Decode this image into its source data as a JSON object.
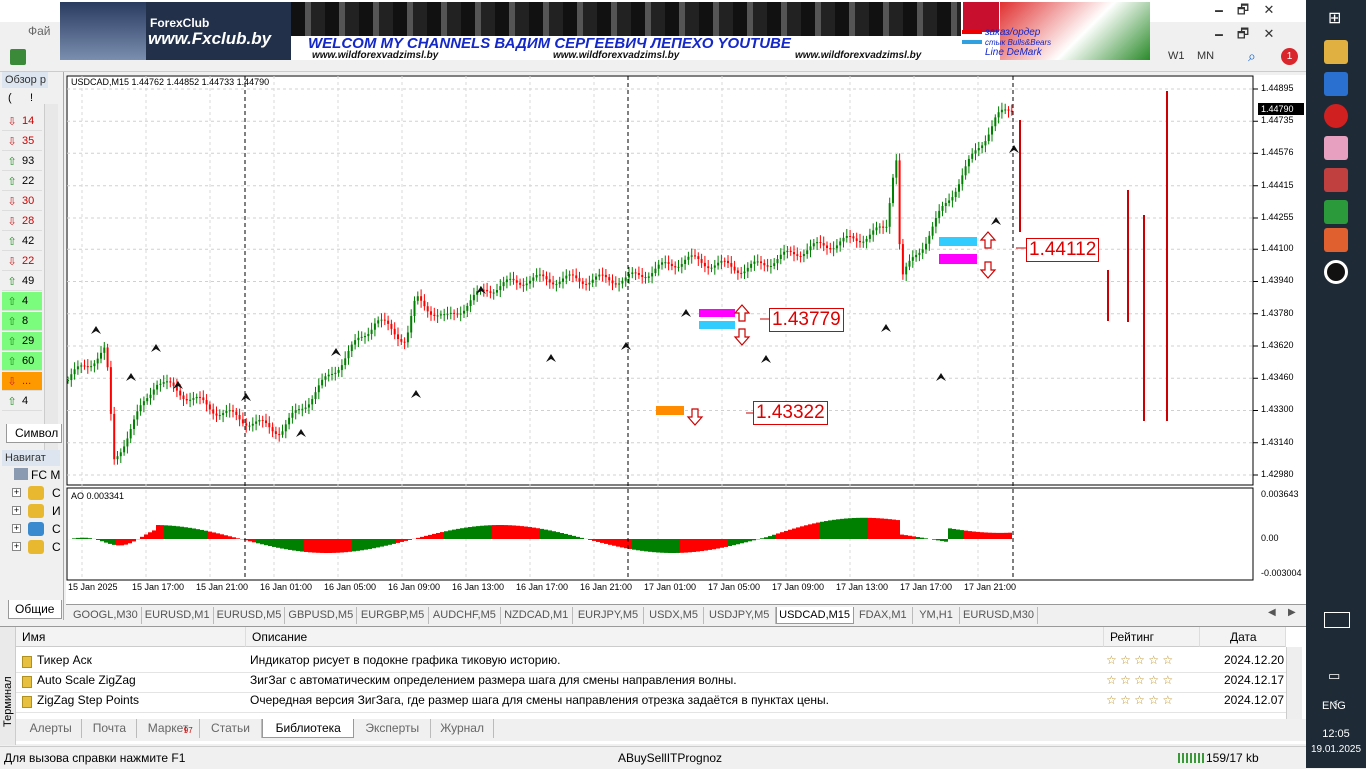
{
  "window": {
    "minimize": "🗕",
    "restore": "🗗",
    "close": "✕",
    "menu_first": "Фай"
  },
  "banner": {
    "logo_text": "ForexClub",
    "site": "www.Fxclub.by",
    "headline": "WELCOM MY CHANNELS ВАДИМ СЕРГЕЕВИЧ ЛЕПЕХО YOUTUBE",
    "url1": "www.wildforexvadzimsl.by",
    "url2": "www.wildforexvadzimsl.by",
    "url3": "www.wildforexvadzimsl.by",
    "legend1": "заказ/ордер",
    "legend2": "стык Bulls&Bears",
    "legend3": "Line DeMark"
  },
  "toolbar": {
    "tf_w1": "W1",
    "tf_mn": "MN",
    "notif_count": "1"
  },
  "market_watch": {
    "title": "Обзор р",
    "col1": "(",
    "col2": "!",
    "rows": [
      {
        "value": "14",
        "dir": "down"
      },
      {
        "value": "35",
        "dir": "down"
      },
      {
        "value": "93",
        "dir": "up"
      },
      {
        "value": "22",
        "dir": "up"
      },
      {
        "value": "30",
        "dir": "down"
      },
      {
        "value": "28",
        "dir": "down"
      },
      {
        "value": "42",
        "dir": "up"
      },
      {
        "value": "22",
        "dir": "down"
      },
      {
        "value": "49",
        "dir": "up"
      },
      {
        "value": "4",
        "dir": "up"
      },
      {
        "value": "8",
        "dir": "up"
      },
      {
        "value": "29",
        "dir": "up"
      },
      {
        "value": "60",
        "dir": "up"
      },
      {
        "value": "...",
        "dir": "down"
      },
      {
        "value": "4",
        "dir": "up"
      }
    ],
    "tab": "Символ"
  },
  "navigator": {
    "title": "Навигат",
    "root": "FC M",
    "items": [
      "C",
      "И",
      "С",
      "С"
    ],
    "tab": "Общие"
  },
  "chart": {
    "header": "USDCAD,M15  1.44762 1.44852 1.44733 1.44790",
    "current_price": "1.44790",
    "price_ticks": [
      "1.44895",
      "1.44735",
      "1.44576",
      "1.44415",
      "1.44255",
      "1.44100",
      "1.43940",
      "1.43780",
      "1.43620",
      "1.43460",
      "1.43300",
      "1.43140",
      "1.42980"
    ],
    "labels": {
      "l1": "1.44112",
      "l2": "1.43779",
      "l3": "1.43322"
    },
    "ao_header": "AO 0.003341",
    "ao_ticks": [
      "0.003643",
      "0.00",
      "-0.003004"
    ],
    "time_ticks": [
      "15 Jan 2025",
      "15 Jan 17:00",
      "15 Jan 21:00",
      "16 Jan 01:00",
      "16 Jan 05:00",
      "16 Jan 09:00",
      "16 Jan 13:00",
      "16 Jan 17:00",
      "16 Jan 21:00",
      "17 Jan 01:00",
      "17 Jan 05:00",
      "17 Jan 09:00",
      "17 Jan 13:00",
      "17 Jan 17:00",
      "17 Jan 21:00"
    ],
    "colors": {
      "bull": "#008000",
      "bear": "#ff0000",
      "level": "#cc0000",
      "magenta": "#ff00ff",
      "cyan": "#33ccff",
      "orange": "#ff8c00"
    }
  },
  "chart_tabs": [
    "GOOGL,M30",
    "EURUSD,M1",
    "EURUSD,M5",
    "GBPUSD,M5",
    "EURGBP,M5",
    "AUDCHF,M5",
    "NZDCAD,M1",
    "EURJPY,M5",
    "USDX,M5",
    "USDJPY,M5",
    "USDCAD,M15",
    "FDAX,M1",
    "YM,H1",
    "EURUSD,M30"
  ],
  "terminal": {
    "side_label": "Терминал",
    "cols": {
      "name": "Имя",
      "desc": "Описание",
      "rating": "Рейтинг",
      "date": "Дата"
    },
    "rows": [
      {
        "name": "Тикер Аск",
        "desc": "Индикатор рисует в подокне графика тиковую историю.",
        "rating": "☆ ☆ ☆ ☆ ☆",
        "date": "2024.12.20"
      },
      {
        "name": "Auto Scale ZigZag",
        "desc": "ЗигЗаг с автоматическим определением размера шага для смены направления волны.",
        "rating": "☆ ☆ ☆ ☆ ☆",
        "date": "2024.12.17"
      },
      {
        "name": "ZigZag Step Points",
        "desc": "Очередная версия ЗигЗага, где размер шага для смены направления отрезка задаётся в пунктах цены.",
        "rating": "☆ ☆ ☆ ☆ ☆",
        "date": "2024.12.07"
      }
    ],
    "tabs": [
      "Алерты",
      "Почта",
      "Маркет",
      "Статьи",
      "Библиотека",
      "Эксперты",
      "Журнал"
    ],
    "market_badge": "97",
    "active_tab": "Библиотека"
  },
  "status": {
    "help": "Для вызова справки нажмите F1",
    "profile": "ABuySellITPrognoz",
    "traffic": "159/17 kb"
  },
  "taskbar": {
    "lang": "ENG",
    "time": "12:05",
    "date": "19.01.2025"
  }
}
